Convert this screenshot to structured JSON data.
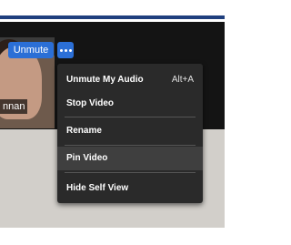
{
  "self_view": {
    "name_label": "nnan"
  },
  "toolbar": {
    "unmute_label": "Unmute",
    "more_icon": "ellipsis-icon"
  },
  "menu": {
    "items": [
      {
        "label": "Unmute My Audio",
        "shortcut": "Alt+A"
      },
      {
        "label": "Stop Video"
      },
      {
        "label": "Rename"
      },
      {
        "label": "Pin Video"
      },
      {
        "label": "Hide Self View"
      }
    ]
  },
  "colors": {
    "accent": "#2b6fd6",
    "menu_bg": "#2a2a2a",
    "top_line": "#1f3f7e"
  }
}
